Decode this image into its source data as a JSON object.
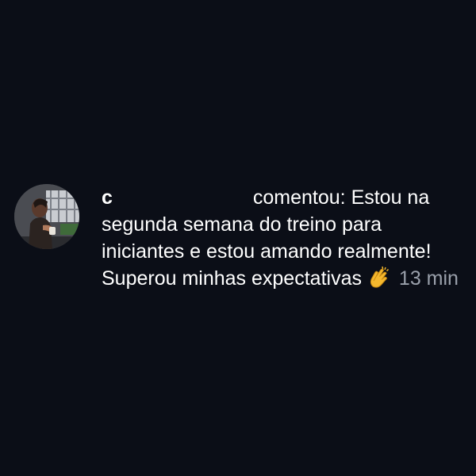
{
  "notification": {
    "username": "c",
    "action": "comentou:",
    "comment": "Estou na segunda semana do treino para iniciantes e estou amando realmente! Superou minhas expectativas",
    "emoji": "clapping-hands-icon",
    "time": "13 min"
  },
  "colors": {
    "background": "#0b0e17",
    "text": "#ffffff",
    "time": "#9aa0ab"
  }
}
